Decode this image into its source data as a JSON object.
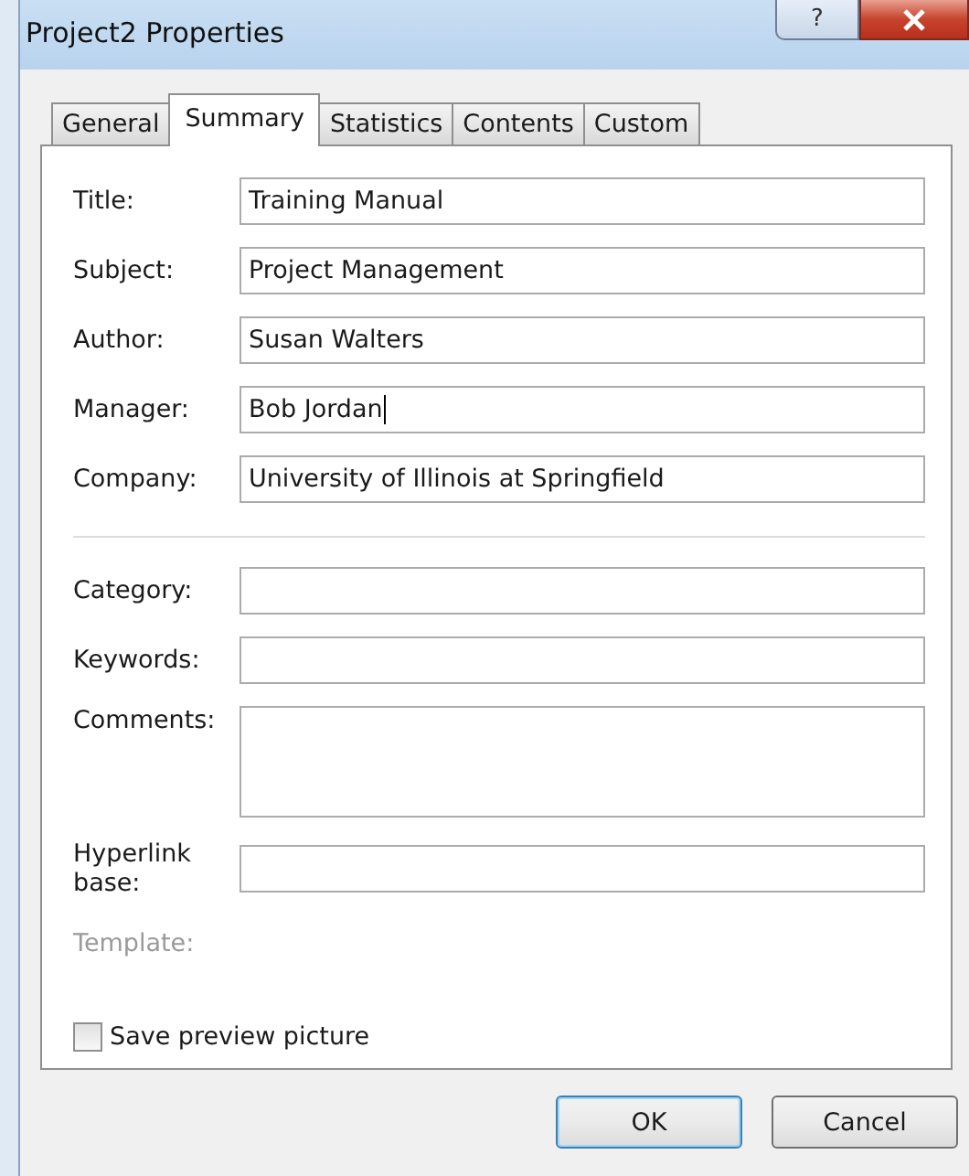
{
  "window": {
    "title": "Project2 Properties",
    "help_button": "?"
  },
  "tabs": [
    {
      "label": "General",
      "selected": false
    },
    {
      "label": "Summary",
      "selected": true
    },
    {
      "label": "Statistics",
      "selected": false
    },
    {
      "label": "Contents",
      "selected": false
    },
    {
      "label": "Custom",
      "selected": false
    }
  ],
  "fields": [
    {
      "label": "Title:",
      "value": "Training Manual",
      "kind": "text",
      "focused": false
    },
    {
      "label": "Subject:",
      "value": "Project Management",
      "kind": "text",
      "focused": false
    },
    {
      "label": "Author:",
      "value": "Susan Walters",
      "kind": "text",
      "focused": false
    },
    {
      "label": "Manager:",
      "value": "Bob Jordan",
      "kind": "text",
      "focused": true
    },
    {
      "label": "Company:",
      "value": "University of Illinois at Springfield",
      "kind": "text",
      "focused": false
    },
    {
      "kind": "separator"
    },
    {
      "label": "Category:",
      "kind": "text",
      "focused": false
    },
    {
      "label": "Keywords:",
      "kind": "text",
      "focused": false
    },
    {
      "label": "Comments:",
      "kind": "multiline",
      "focused": false
    },
    {
      "label": "Hyperlink base:",
      "kind": "text",
      "focused": false
    },
    {
      "label": "Template:",
      "kind": "static",
      "disabled": true
    }
  ],
  "save_preview": {
    "label": "Save preview picture",
    "checked": false
  },
  "buttons": [
    {
      "label": "OK",
      "default": true
    },
    {
      "label": "Cancel",
      "default": false
    }
  ]
}
